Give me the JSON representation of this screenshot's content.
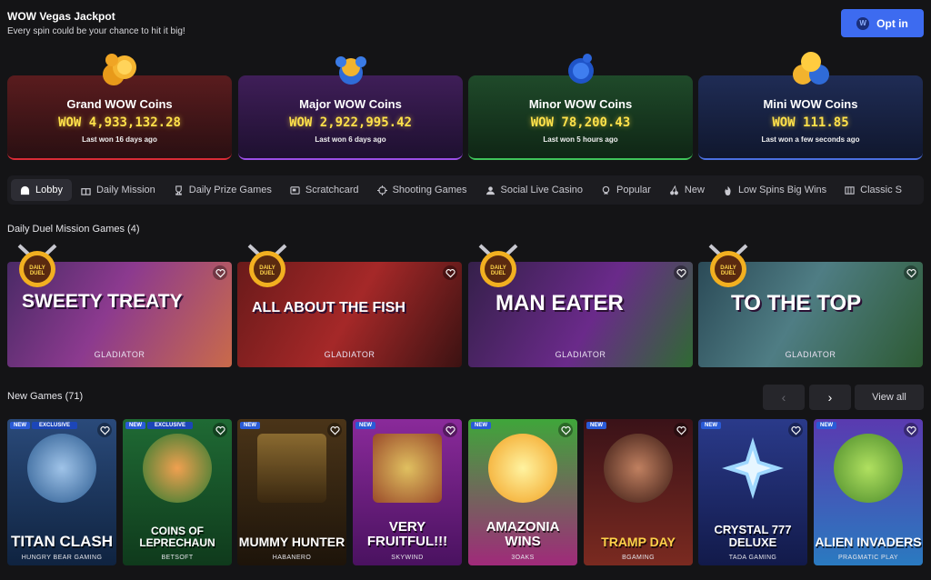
{
  "jackpot": {
    "title": "WOW Vegas Jackpot",
    "subtitle": "Every spin could be your chance to hit it big!",
    "optin_label": "Opt in",
    "tiers": [
      {
        "name": "Grand WOW Coins",
        "amount": "WOW 4,933,132.28",
        "last": "Last won 16 days ago"
      },
      {
        "name": "Major WOW Coins",
        "amount": "WOW 2,922,995.42",
        "last": "Last won 6 days ago"
      },
      {
        "name": "Minor WOW Coins",
        "amount": "WOW 78,200.43",
        "last": "Last won 5 hours ago"
      },
      {
        "name": "Mini WOW Coins",
        "amount": "WOW 111.85",
        "last": "Last won a few seconds ago"
      }
    ]
  },
  "nav": {
    "items": [
      {
        "label": "Lobby",
        "icon": "lobby-icon"
      },
      {
        "label": "Daily Mission",
        "icon": "gift-icon"
      },
      {
        "label": "Daily Prize Games",
        "icon": "trophy-icon"
      },
      {
        "label": "Scratchcard",
        "icon": "card-icon"
      },
      {
        "label": "Shooting Games",
        "icon": "crosshair-icon"
      },
      {
        "label": "Social Live Casino",
        "icon": "dealer-icon"
      },
      {
        "label": "Popular",
        "icon": "medal-icon"
      },
      {
        "label": "New",
        "icon": "cherry-icon"
      },
      {
        "label": "Low Spins Big Wins",
        "icon": "flame-icon"
      },
      {
        "label": "Classic S",
        "icon": "slot-icon"
      }
    ]
  },
  "duel": {
    "title": "Daily Duel Mission Games (4)",
    "badge_text": "DAILY DUEL",
    "games": [
      {
        "title": "SWEETY TREATY",
        "provider": "GLADIATOR"
      },
      {
        "title": "ALL ABOUT THE FISH",
        "provider": "GLADIATOR"
      },
      {
        "title": "MAN EATER",
        "provider": "GLADIATOR"
      },
      {
        "title": "TO THE TOP",
        "provider": "GLADIATOR"
      }
    ]
  },
  "new_games": {
    "title": "New Games (71)",
    "prev_label": "‹",
    "next_label": "›",
    "view_all_label": "View all",
    "tag_new": "NEW",
    "tag_exclusive": "EXCLUSIVE",
    "games": [
      {
        "title": "TITAN CLASH",
        "provider": "HUNGRY BEAR GAMING",
        "exclusive": true
      },
      {
        "title": "COINS OF LEPRECHAUN",
        "provider": "BETSOFT",
        "exclusive": true
      },
      {
        "title": "MUMMY HUNTER",
        "provider": "HABANERO",
        "exclusive": false
      },
      {
        "title": "VERY FRUITFUL!!!",
        "provider": "SKYWIND",
        "exclusive": false
      },
      {
        "title": "AMAZONIA WINS",
        "provider": "3OAKS",
        "exclusive": false
      },
      {
        "title": "TRAMP DAY",
        "provider": "BGAMING",
        "exclusive": false
      },
      {
        "title": "CRYSTAL 777 DELUXE",
        "provider": "TADA GAMING",
        "exclusive": false
      },
      {
        "title": "ALIEN INVADERS",
        "provider": "PRAGMATIC PLAY",
        "exclusive": false
      }
    ]
  }
}
